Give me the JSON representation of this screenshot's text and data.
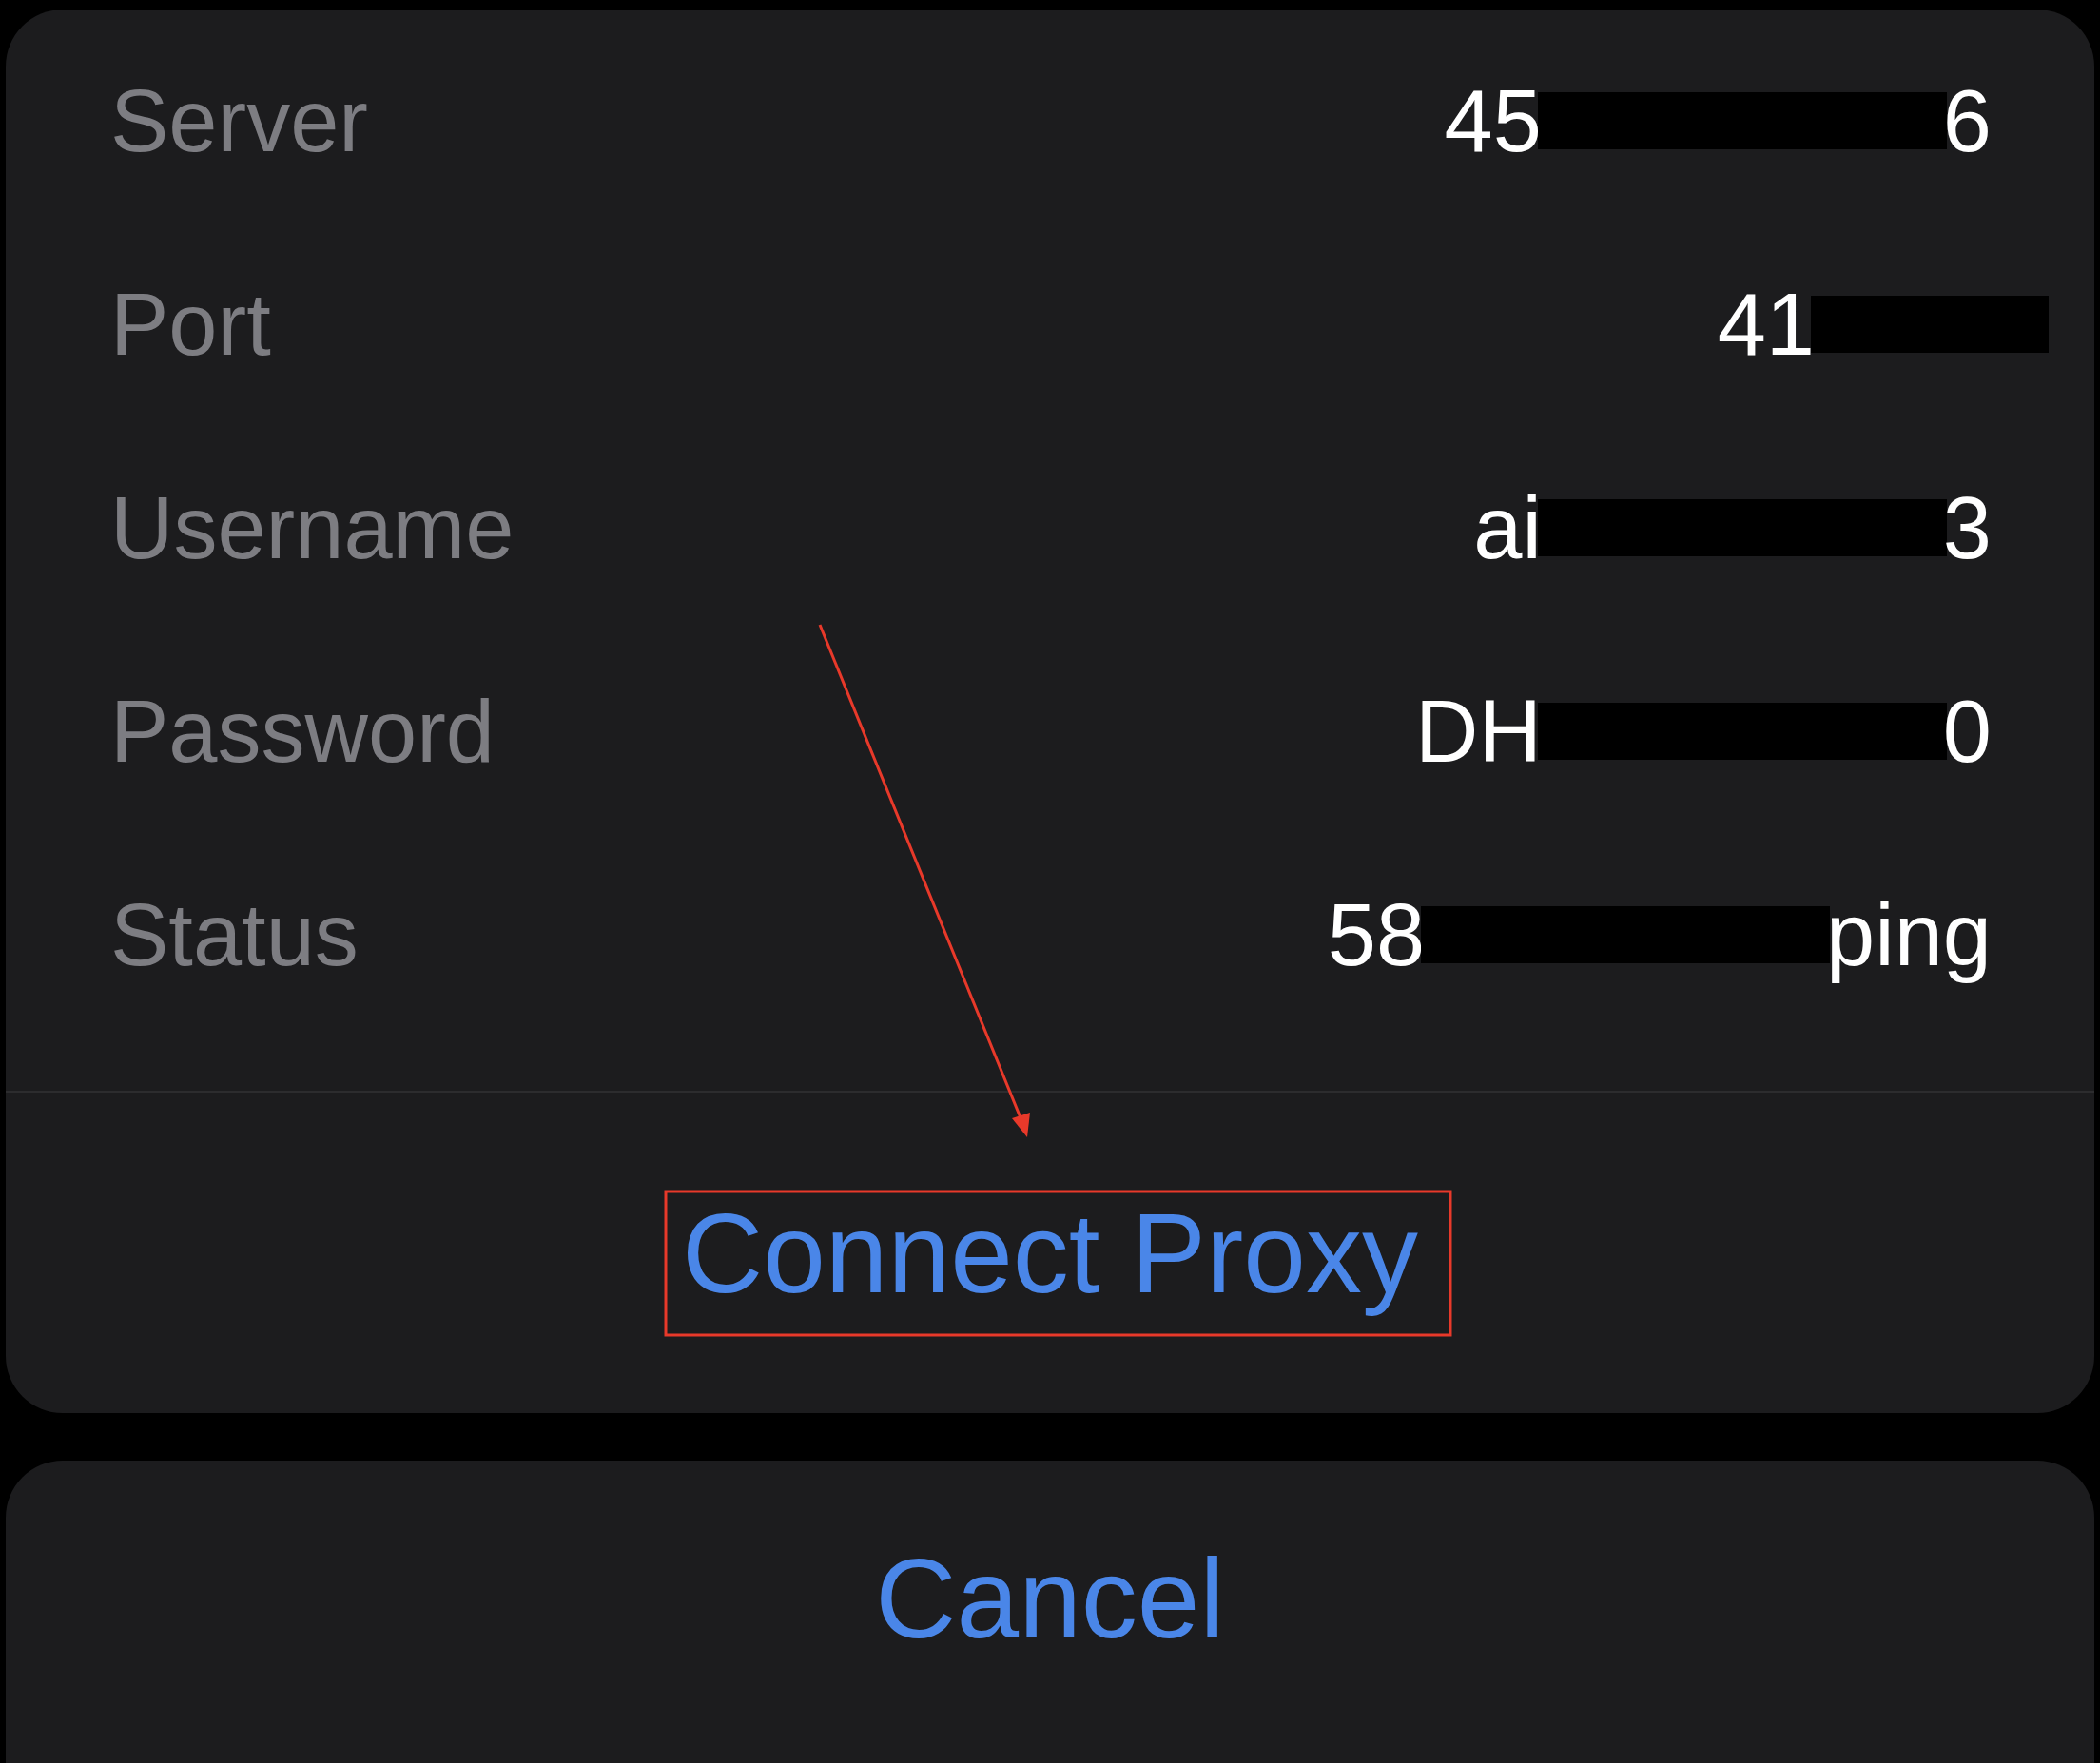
{
  "details": [
    {
      "label": "Server",
      "value_start": "45",
      "value_end": "6"
    },
    {
      "label": "Port",
      "value_start": "41"
    },
    {
      "label": "Username",
      "value_start": "ai",
      "value_end": "3"
    },
    {
      "label": "Password",
      "value_start": "DH",
      "value_end": "0"
    },
    {
      "label": "Status",
      "value_start": "58",
      "value_end": "ping"
    }
  ],
  "connect_button": "Connect Proxy",
  "cancel_button": "Cancel"
}
